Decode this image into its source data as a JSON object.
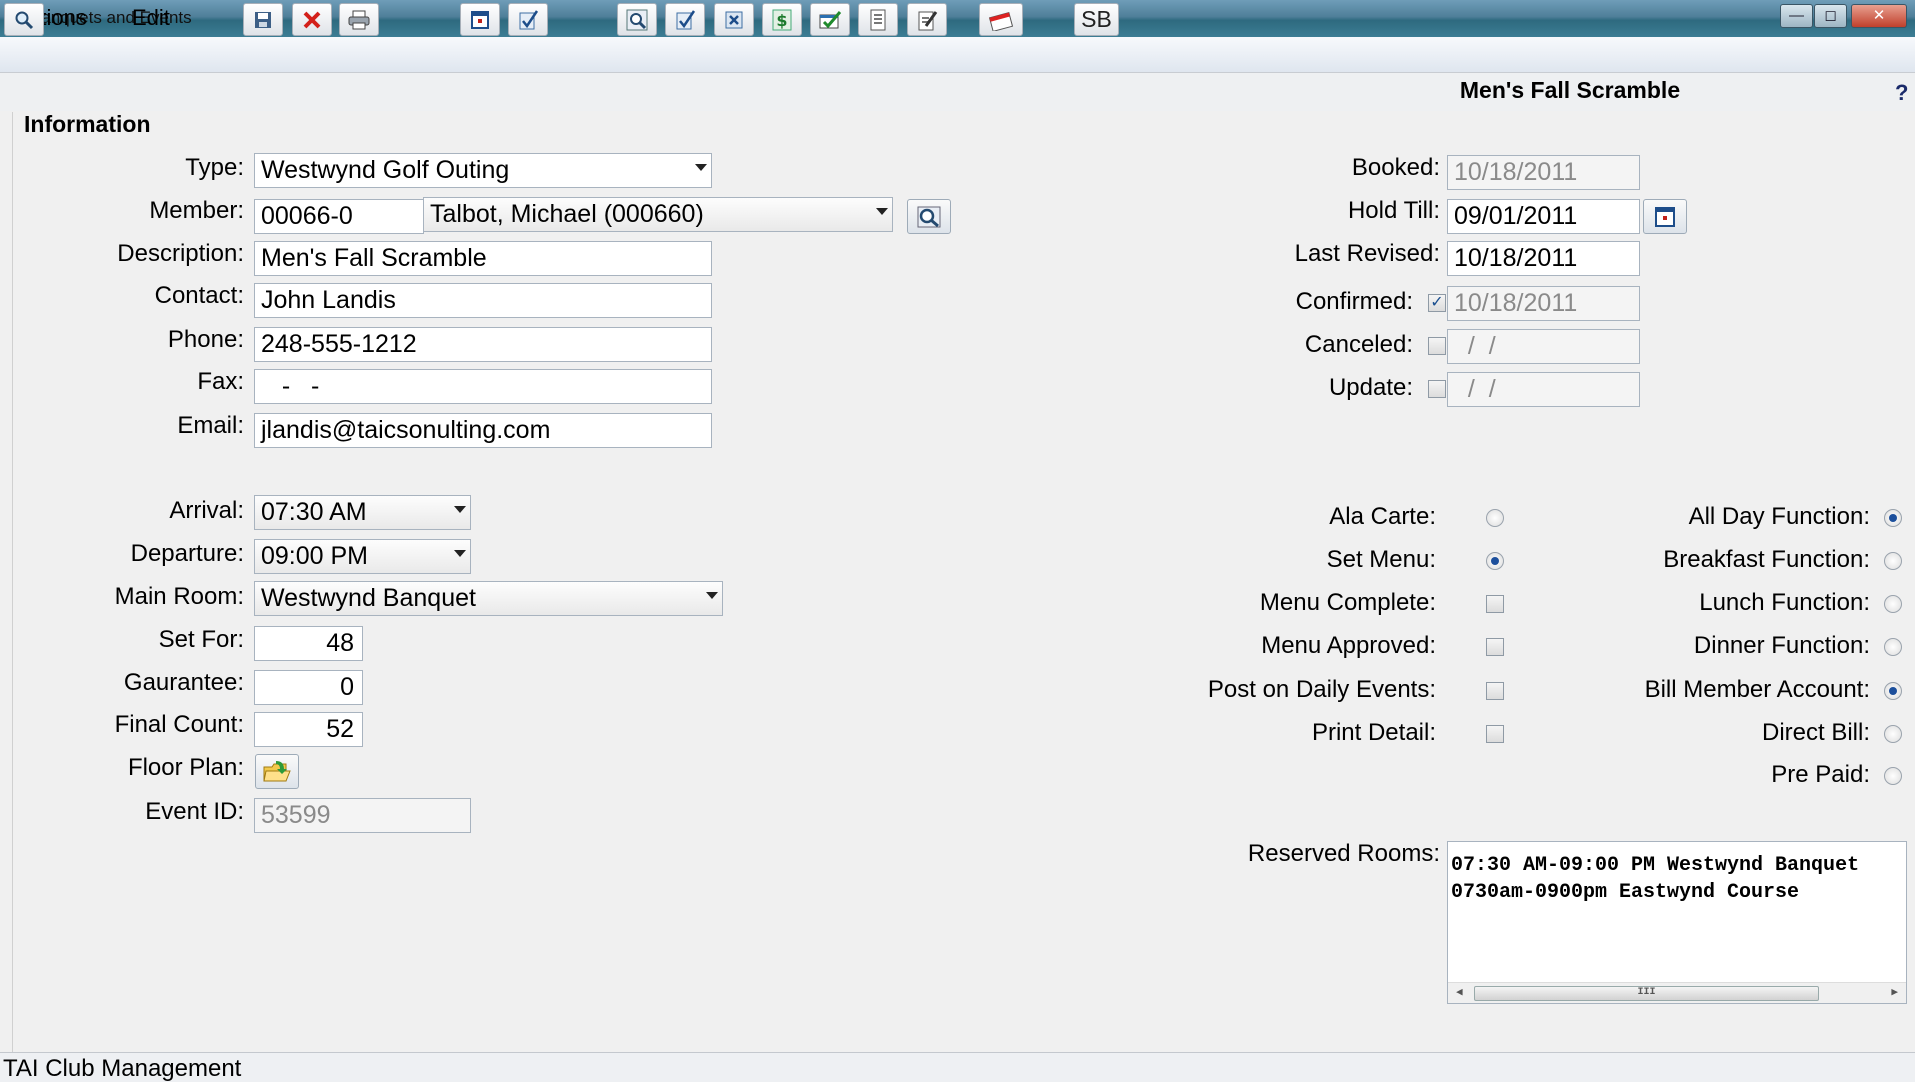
{
  "window": {
    "title": "Banquets and Events",
    "minimize": "—",
    "maximize": "◻",
    "close": "✕"
  },
  "menu": {
    "options": "Options",
    "edit": "Edit"
  },
  "toolbar": {
    "event_title": "Men's Fall Scramble",
    "sb_label": "SB",
    "help": "?"
  },
  "section": {
    "title": "Information"
  },
  "form": {
    "type": {
      "label": "Type:",
      "value": "Westwynd Golf Outing"
    },
    "member": {
      "label": "Member:",
      "number": "00066-0",
      "name": "Talbot, Michael (000660)"
    },
    "description": {
      "label": "Description:",
      "value": "Men's Fall Scramble"
    },
    "contact": {
      "label": "Contact:",
      "value": "John Landis"
    },
    "phone": {
      "label": "Phone:",
      "value": "248-555-1212"
    },
    "fax": {
      "label": "Fax:",
      "value": "   -   -"
    },
    "email": {
      "label": "Email:",
      "value": "jlandis@taicsonulting.com"
    },
    "arrival": {
      "label": "Arrival:",
      "value": "07:30 AM"
    },
    "departure": {
      "label": "Departure:",
      "value": "09:00 PM"
    },
    "main_room": {
      "label": "Main Room:",
      "value": "Westwynd Banquet"
    },
    "set_for": {
      "label": "Set For:",
      "value": "48"
    },
    "guarantee": {
      "label": "Gaurantee:",
      "value": "0"
    },
    "final_count": {
      "label": "Final Count:",
      "value": "52"
    },
    "floor_plan": {
      "label": "Floor Plan:"
    },
    "event_id": {
      "label": "Event ID:",
      "value": "53599"
    }
  },
  "dates": {
    "booked": {
      "label": "Booked:",
      "value": "10/18/2011"
    },
    "hold_till": {
      "label": "Hold Till:",
      "value": "09/01/2011"
    },
    "last_revised": {
      "label": "Last Revised:",
      "value": "10/18/2011"
    },
    "confirmed": {
      "label": "Confirmed:",
      "value": "10/18/2011",
      "checked": true
    },
    "canceled": {
      "label": "Canceled:",
      "value": "  /  /",
      "checked": false
    },
    "update": {
      "label": "Update:",
      "value": "  /  /",
      "checked": false
    }
  },
  "options_left": {
    "ala_carte": {
      "label": "Ala Carte:",
      "selected": false
    },
    "set_menu": {
      "label": "Set Menu:",
      "selected": true
    },
    "menu_complete": {
      "label": "Menu Complete:",
      "checked": false
    },
    "menu_approved": {
      "label": "Menu Approved:",
      "checked": false
    },
    "post_daily": {
      "label": "Post on Daily Events:",
      "checked": false
    },
    "print_detail": {
      "label": "Print Detail:",
      "checked": false
    }
  },
  "options_right": {
    "all_day": {
      "label": "All Day Function:",
      "selected": true
    },
    "breakfast": {
      "label": "Breakfast Function:",
      "selected": false
    },
    "lunch": {
      "label": "Lunch Function:",
      "selected": false
    },
    "dinner": {
      "label": "Dinner Function:",
      "selected": false
    },
    "bill_member": {
      "label": "Bill Member Account:",
      "selected": true
    },
    "direct_bill": {
      "label": "Direct Bill:",
      "selected": false
    },
    "pre_paid": {
      "label": "Pre Paid:",
      "selected": false
    }
  },
  "reserved_rooms": {
    "label": "Reserved Rooms:",
    "lines": [
      "07:30 AM-09:00 PM Westwynd Banquet",
      "0730am-0900pm Eastwynd Course"
    ],
    "scroll_thumb": "III"
  },
  "status": {
    "text": "TAI Club Management"
  },
  "colors": {
    "title_bar": "#3c7d94",
    "radio_on": "#1c4f9c",
    "background": "#f0f0f0"
  }
}
